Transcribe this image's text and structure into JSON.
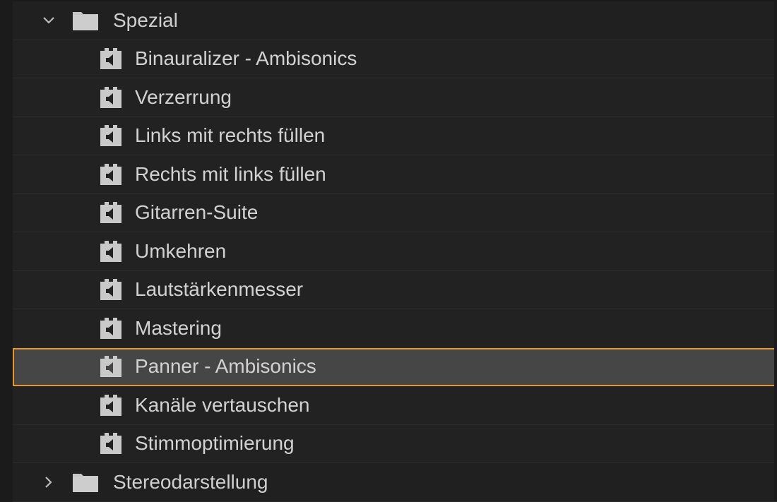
{
  "tree": {
    "folder_open": {
      "label": "Spezial",
      "expanded": true
    },
    "effects": [
      {
        "label": "Binauralizer - Ambisonics",
        "icon": "audio-effect-icon"
      },
      {
        "label": "Verzerrung",
        "icon": "audio-effect-icon"
      },
      {
        "label": "Links mit rechts füllen",
        "icon": "audio-effect-icon"
      },
      {
        "label": "Rechts mit links füllen",
        "icon": "audio-effect-icon"
      },
      {
        "label": "Gitarren-Suite",
        "icon": "audio-effect-icon"
      },
      {
        "label": "Umkehren",
        "icon": "audio-effect-icon"
      },
      {
        "label": "Lautstärkenmesser",
        "icon": "audio-effect-icon"
      },
      {
        "label": "Mastering",
        "icon": "audio-effect-icon"
      },
      {
        "label": "Panner - Ambisonics",
        "icon": "audio-effect-icon",
        "selected": true
      },
      {
        "label": "Kanäle vertauschen",
        "icon": "audio-effect-icon"
      },
      {
        "label": "Stimmoptimierung",
        "icon": "audio-effect-icon"
      }
    ],
    "folder_closed": {
      "label": "Stereodarstellung",
      "expanded": false
    }
  },
  "colors": {
    "selection_outline": "#e8952c",
    "selection_fill": "#464646",
    "row_bg": "#222222",
    "text": "#d2d2d2",
    "icon": "#c9c9c9"
  }
}
